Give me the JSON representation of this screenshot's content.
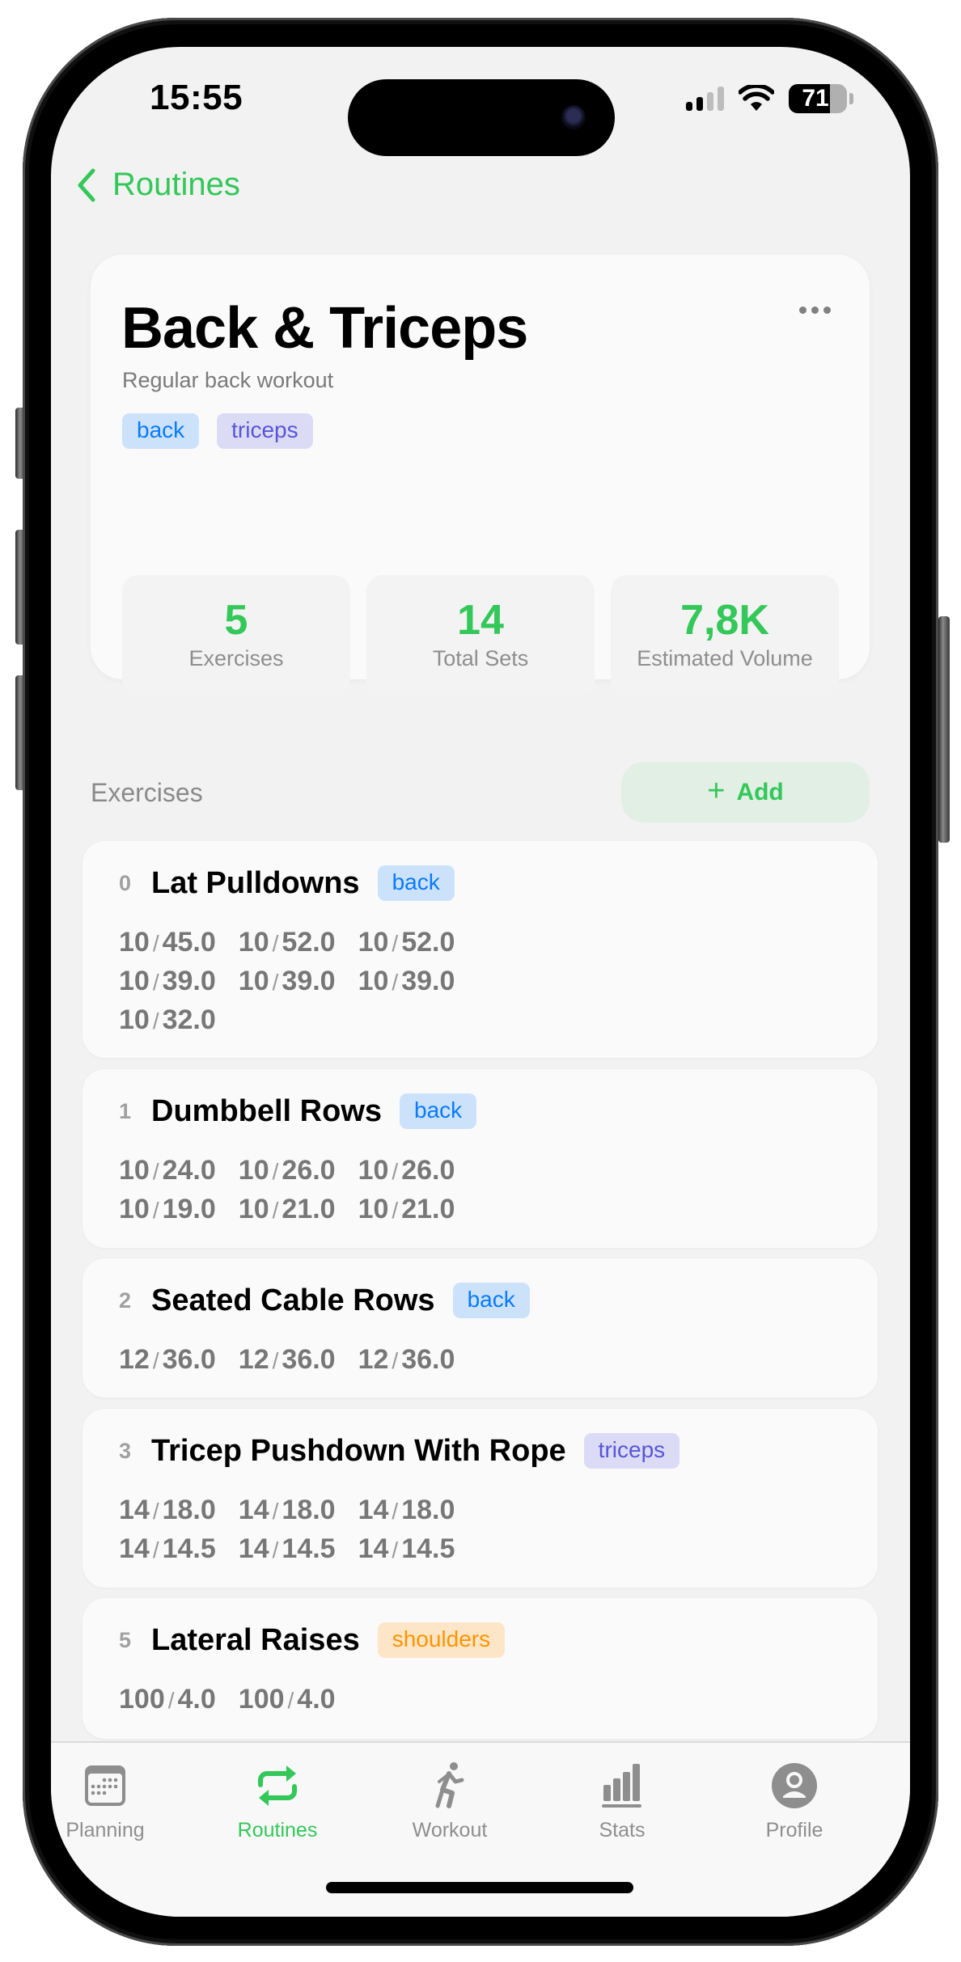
{
  "status_bar": {
    "time": "15:55",
    "battery_percent": "71",
    "battery_level": 0.71,
    "signal_bars_active": 2,
    "signal_bars_total": 4
  },
  "nav": {
    "back_label": "Routines"
  },
  "routine": {
    "title": "Back & Triceps",
    "description": "Regular back workout",
    "more_icon": "ellipsis-icon",
    "tags": [
      {
        "label": "back",
        "color": "#0a7aff",
        "bg": "#cce2fb"
      },
      {
        "label": "triceps",
        "color": "#5856d6",
        "bg": "#dcdbf5"
      }
    ],
    "stats": [
      {
        "value": "5",
        "label": "Exercises"
      },
      {
        "value": "14",
        "label": "Total Sets"
      },
      {
        "value": "7,8K",
        "label": "Estimated Volume"
      }
    ]
  },
  "exercises_section": {
    "title": "Exercises",
    "add_label": "Add",
    "add_icon": "plus-icon"
  },
  "exercises": [
    {
      "index": "0",
      "name": "Lat Pulldowns",
      "tag": {
        "label": "back",
        "color": "#0a7aff",
        "bg": "#cce2fb"
      },
      "sets": [
        {
          "reps": "10",
          "weight": "45.0"
        },
        {
          "reps": "10",
          "weight": "52.0"
        },
        {
          "reps": "10",
          "weight": "52.0"
        },
        {
          "reps": "10",
          "weight": "39.0"
        },
        {
          "reps": "10",
          "weight": "39.0"
        },
        {
          "reps": "10",
          "weight": "39.0"
        },
        {
          "reps": "10",
          "weight": "32.0"
        }
      ]
    },
    {
      "index": "1",
      "name": "Dumbbell Rows",
      "tag": {
        "label": "back",
        "color": "#0a7aff",
        "bg": "#cce2fb"
      },
      "sets": [
        {
          "reps": "10",
          "weight": "24.0"
        },
        {
          "reps": "10",
          "weight": "26.0"
        },
        {
          "reps": "10",
          "weight": "26.0"
        },
        {
          "reps": "10",
          "weight": "19.0"
        },
        {
          "reps": "10",
          "weight": "21.0"
        },
        {
          "reps": "10",
          "weight": "21.0"
        }
      ]
    },
    {
      "index": "2",
      "name": "Seated Cable Rows",
      "tag": {
        "label": "back",
        "color": "#0a7aff",
        "bg": "#cce2fb"
      },
      "sets": [
        {
          "reps": "12",
          "weight": "36.0"
        },
        {
          "reps": "12",
          "weight": "36.0"
        },
        {
          "reps": "12",
          "weight": "36.0"
        }
      ]
    },
    {
      "index": "3",
      "name": "Tricep Pushdown With Rope",
      "tag": {
        "label": "triceps",
        "color": "#5856d6",
        "bg": "#dcdbf5"
      },
      "sets": [
        {
          "reps": "14",
          "weight": "18.0"
        },
        {
          "reps": "14",
          "weight": "18.0"
        },
        {
          "reps": "14",
          "weight": "18.0"
        },
        {
          "reps": "14",
          "weight": "14.5"
        },
        {
          "reps": "14",
          "weight": "14.5"
        },
        {
          "reps": "14",
          "weight": "14.5"
        }
      ]
    },
    {
      "index": "5",
      "name": "Lateral Raises",
      "tag": {
        "label": "shoulders",
        "color": "#ff9500",
        "bg": "#fde5c8"
      },
      "sets": [
        {
          "reps": "100",
          "weight": "4.0"
        },
        {
          "reps": "100",
          "weight": "4.0"
        }
      ]
    }
  ],
  "set_separator": "/",
  "tab_bar": {
    "active_color": "#34c759",
    "inactive_color": "#8e8e8e",
    "tabs": [
      {
        "label": "Planning",
        "icon": "calendar-icon",
        "active": false
      },
      {
        "label": "Routines",
        "icon": "repeat-icon",
        "active": true
      },
      {
        "label": "Workout",
        "icon": "running-figure-icon",
        "active": false
      },
      {
        "label": "Stats",
        "icon": "bar-chart-icon",
        "active": false
      },
      {
        "label": "Profile",
        "icon": "person-circle-icon",
        "active": false
      }
    ]
  }
}
